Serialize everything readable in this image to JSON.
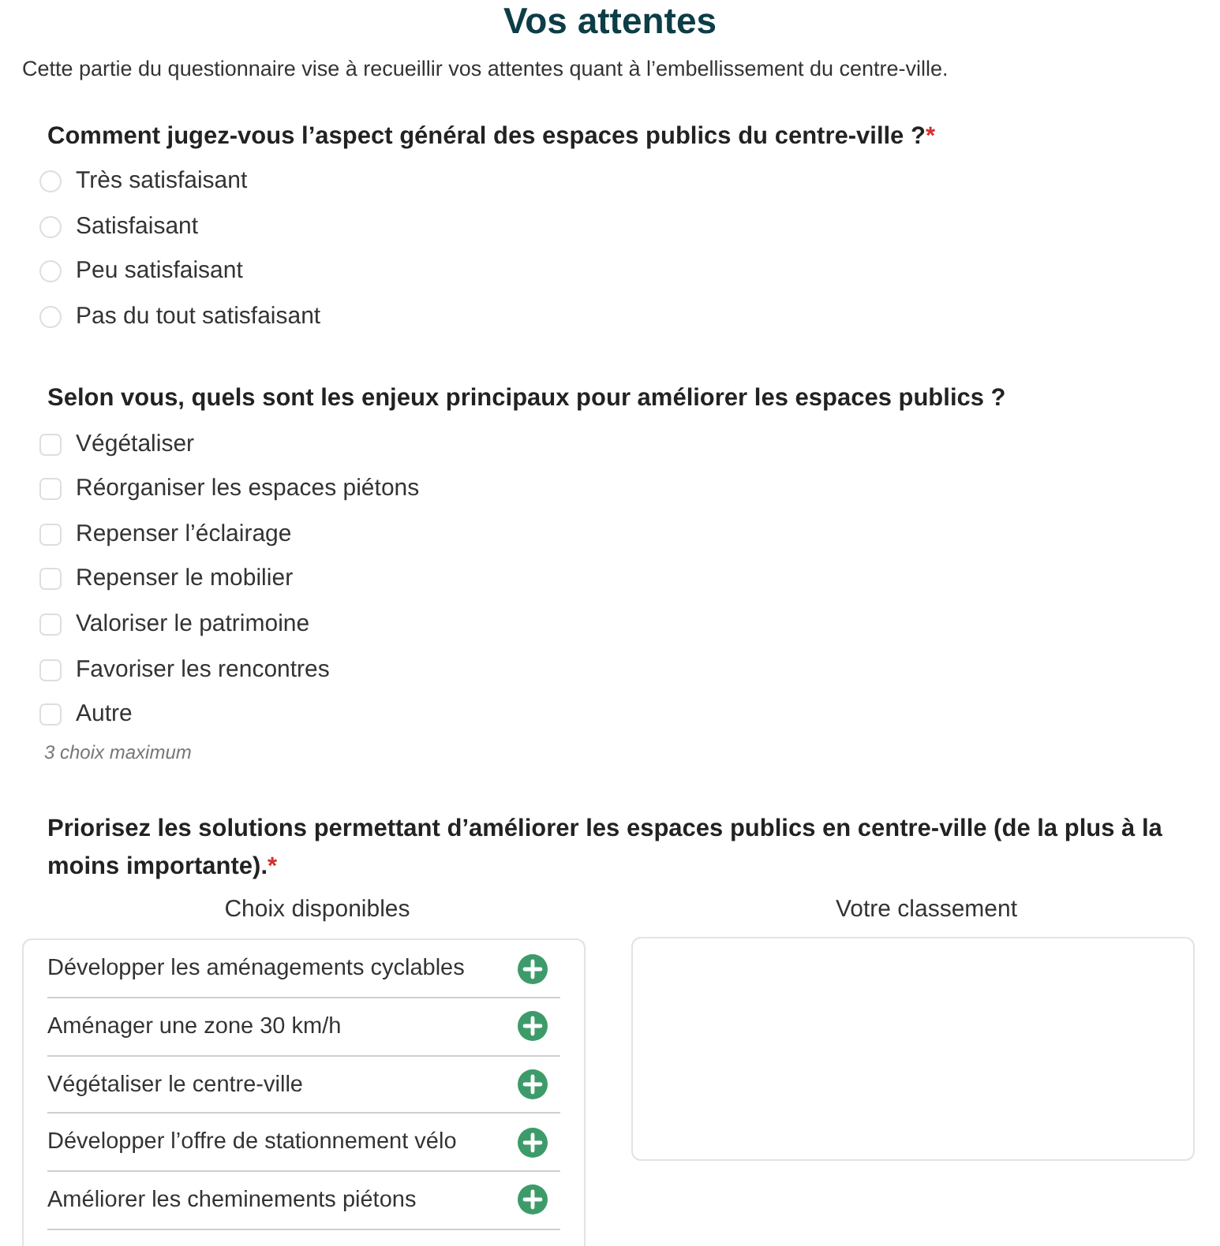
{
  "title": "Vos attentes",
  "intro": "Cette partie du questionnaire vise à recueillir vos attentes quant à l’embellissement du centre-ville.",
  "questions": [
    {
      "kind": "radio",
      "label": "Comment jugez-vous l’aspect général des espaces publics du centre-ville ?",
      "required_mark": "*",
      "options": [
        {
          "label": "Très satisfaisant",
          "selected": false
        },
        {
          "label": "Satisfaisant",
          "selected": false
        },
        {
          "label": "Peu satisfaisant",
          "selected": false
        },
        {
          "label": "Pas du tout satisfaisant",
          "selected": false
        }
      ]
    },
    {
      "kind": "checkbox",
      "label": "Selon vous, quels sont les enjeux principaux pour améliorer les espaces publics ?",
      "options": [
        {
          "label": "Végétaliser",
          "checked": false
        },
        {
          "label": "Réorganiser les espaces piétons",
          "checked": false
        },
        {
          "label": "Repenser l’éclairage",
          "checked": false
        },
        {
          "label": "Repenser le mobilier",
          "checked": false
        },
        {
          "label": "Valoriser le patrimoine",
          "checked": false
        },
        {
          "label": "Favoriser les rencontres",
          "checked": false
        },
        {
          "label": "Autre",
          "checked": false
        }
      ],
      "hint": "3 choix maximum"
    },
    {
      "kind": "ranking",
      "label": "Priorisez les solutions permettant d’améliorer les espaces publics en centre-ville (de la plus à la moins importante).",
      "required_mark": "*",
      "available_heading": "Choix disponibles",
      "ranking_heading": "Votre classement",
      "available": [
        {
          "label": "Développer les aménagements cyclables"
        },
        {
          "label": "Aménager une zone 30 km/h"
        },
        {
          "label": "Végétaliser le centre-ville"
        },
        {
          "label": "Développer l’offre de stationnement vélo"
        },
        {
          "label": "Améliorer les cheminements piétons"
        }
      ]
    }
  ]
}
